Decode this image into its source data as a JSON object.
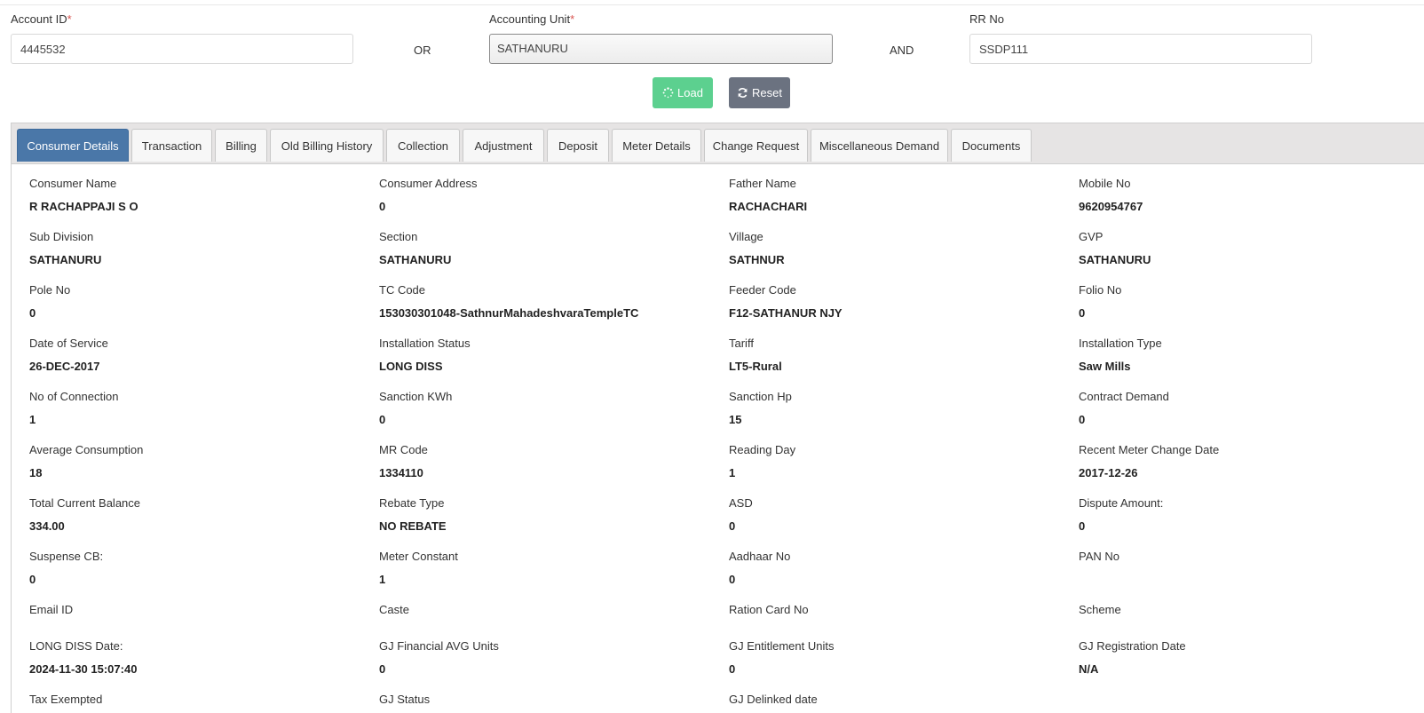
{
  "search": {
    "account_id": {
      "label": "Account ID",
      "required_mark": "*",
      "value": "4445532"
    },
    "or_label": "OR",
    "accounting_unit": {
      "label": "Accounting Unit",
      "required_mark": "*",
      "value": "SATHANURU"
    },
    "and_label": "AND",
    "rr_no": {
      "label": "RR No",
      "value": "SSDP111"
    },
    "load_label": "Load",
    "reset_label": "Reset"
  },
  "tabs": [
    {
      "label": "Consumer Details",
      "active": true
    },
    {
      "label": "Transaction"
    },
    {
      "label": "Billing"
    },
    {
      "label": "Old Billing History"
    },
    {
      "label": "Collection"
    },
    {
      "label": "Adjustment"
    },
    {
      "label": "Deposit"
    },
    {
      "label": "Meter Details"
    },
    {
      "label": "Change Request"
    },
    {
      "label": "Miscellaneous Demand"
    },
    {
      "label": "Documents"
    }
  ],
  "details": [
    [
      {
        "label": "Consumer Name",
        "value": "R RACHAPPAJI S O"
      },
      {
        "label": "Consumer Address",
        "value": "0"
      },
      {
        "label": "Father Name",
        "value": "RACHACHARI"
      },
      {
        "label": "Mobile No",
        "value": "9620954767"
      }
    ],
    [
      {
        "label": "Sub Division",
        "value": "SATHANURU"
      },
      {
        "label": "Section",
        "value": "SATHANURU"
      },
      {
        "label": "Village",
        "value": "SATHNUR"
      },
      {
        "label": "GVP",
        "value": "SATHANURU"
      }
    ],
    [
      {
        "label": "Pole No",
        "value": "0"
      },
      {
        "label": "TC Code",
        "value": "153030301048-SathnurMahadeshvaraTempleTC"
      },
      {
        "label": "Feeder Code",
        "value": "F12-SATHANUR NJY"
      },
      {
        "label": "Folio No",
        "value": "0"
      }
    ],
    [
      {
        "label": "Date of Service",
        "value": "26-DEC-2017"
      },
      {
        "label": "Installation Status",
        "value": "LONG DISS"
      },
      {
        "label": "Tariff",
        "value": "LT5-Rural"
      },
      {
        "label": "Installation Type",
        "value": "Saw Mills"
      }
    ],
    [
      {
        "label": "No of Connection",
        "value": "1"
      },
      {
        "label": "Sanction KWh",
        "value": "0"
      },
      {
        "label": "Sanction Hp",
        "value": "15"
      },
      {
        "label": "Contract Demand",
        "value": "0"
      }
    ],
    [
      {
        "label": "Average Consumption",
        "value": "18"
      },
      {
        "label": "MR Code",
        "value": "1334110"
      },
      {
        "label": "Reading Day",
        "value": "1"
      },
      {
        "label": "Recent Meter Change Date",
        "value": "2017-12-26"
      }
    ],
    [
      {
        "label": "Total Current Balance",
        "value": "334.00"
      },
      {
        "label": "Rebate Type",
        "value": "NO REBATE"
      },
      {
        "label": "ASD",
        "value": "0"
      },
      {
        "label": "Dispute Amount:",
        "value": "0"
      }
    ],
    [
      {
        "label": "Suspense CB:",
        "value": "0"
      },
      {
        "label": "Meter Constant",
        "value": "1"
      },
      {
        "label": "Aadhaar No",
        "value": "0"
      },
      {
        "label": "PAN No",
        "value": ""
      }
    ],
    [
      {
        "label": "Email ID",
        "value": ""
      },
      {
        "label": "Caste",
        "value": ""
      },
      {
        "label": "Ration Card No",
        "value": ""
      },
      {
        "label": "Scheme",
        "value": ""
      }
    ],
    [
      {
        "label": "LONG DISS Date:",
        "value": "2024-11-30 15:07:40"
      },
      {
        "label": "GJ Financial AVG Units",
        "value": "0"
      },
      {
        "label": "GJ Entitlement Units",
        "value": "0"
      },
      {
        "label": "GJ Registration Date",
        "value": "N/A"
      }
    ],
    [
      {
        "label": "Tax Exempted",
        "value": ""
      },
      {
        "label": "GJ Status",
        "value": ""
      },
      {
        "label": "GJ Delinked date",
        "value": ""
      }
    ]
  ]
}
